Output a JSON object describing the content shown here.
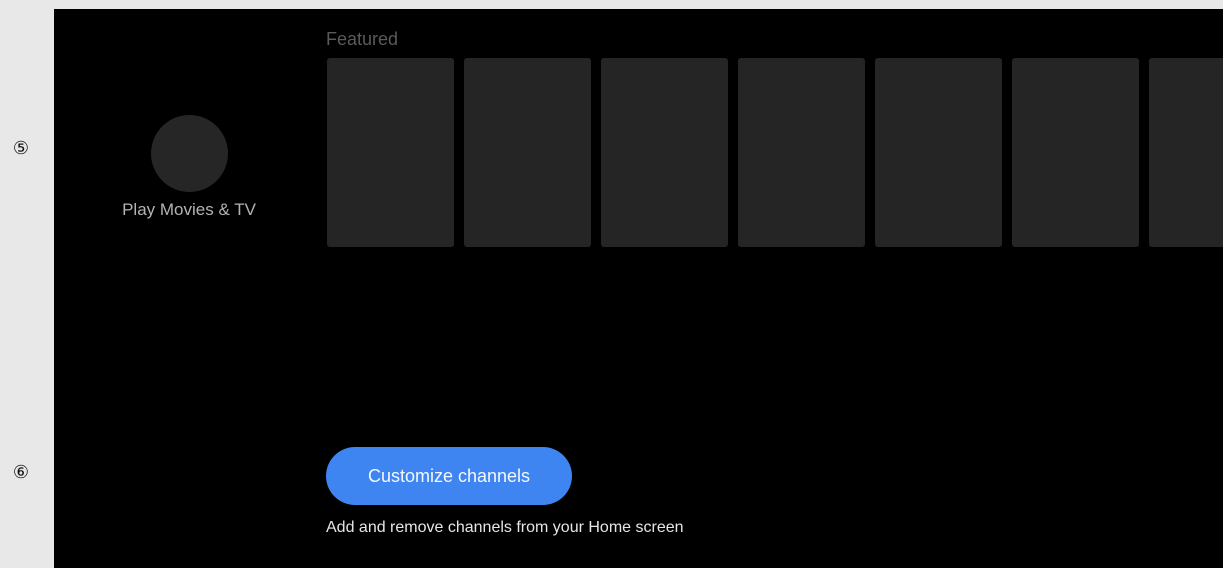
{
  "markers": [
    "⑤",
    "⑥"
  ],
  "app": {
    "name": "Play Movies & TV"
  },
  "featured_row": {
    "title": "Featured",
    "card_count_visible": 7
  },
  "customize": {
    "button_label": "Customize channels",
    "description": "Add and remove channels from your Home screen"
  },
  "colors": {
    "background": "#000000",
    "card": "#252525",
    "button": "#3f85f1",
    "gutter": "#e8e8e8"
  }
}
